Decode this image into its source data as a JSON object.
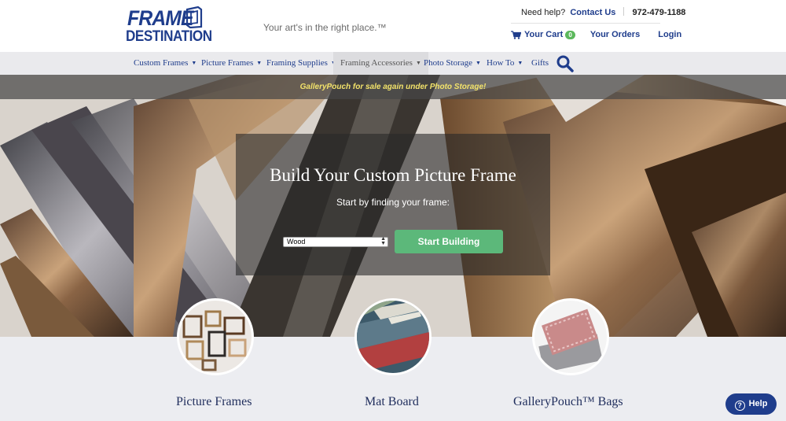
{
  "header": {
    "logo_line1": "FRAME",
    "logo_line2": "DESTINATION",
    "tagline": "Your art's in the right place.™",
    "need_help": "Need help?",
    "contact_us": "Contact Us",
    "phone": "972-479-1188",
    "your_cart": "Your Cart",
    "cart_count": "0",
    "your_orders": "Your Orders",
    "login": "Login"
  },
  "nav": {
    "items": [
      {
        "label": "Custom Frames",
        "has_caret": true
      },
      {
        "label": "Picture Frames",
        "has_caret": true
      },
      {
        "label": "Framing Supplies",
        "has_caret": true
      },
      {
        "label": "Framing Accessories",
        "has_caret": true,
        "active": true
      },
      {
        "label": "Photo Storage",
        "has_caret": true
      },
      {
        "label": "How To",
        "has_caret": true
      },
      {
        "label": "Gifts",
        "has_caret": false
      }
    ],
    "search_icon": "magnifier-icon"
  },
  "hero": {
    "announcement": "GalleryPouch for sale again under Photo Storage!",
    "title": "Build Your Custom Picture Frame",
    "subtitle": "Start by finding your frame:",
    "select_value": "Wood",
    "button": "Start Building"
  },
  "categories": [
    {
      "label": "Picture Frames",
      "icon": "picture-frames-image"
    },
    {
      "label": "Mat Board",
      "icon": "mat-board-image"
    },
    {
      "label": "GalleryPouch™ Bags",
      "icon": "gallerypouch-image"
    }
  ],
  "help_button": "Help",
  "colors": {
    "brand_blue": "#1f3d8c",
    "start_green": "#5cb87a",
    "announcement_yellow": "#f3e36a",
    "badge_green": "#5cb85c"
  }
}
